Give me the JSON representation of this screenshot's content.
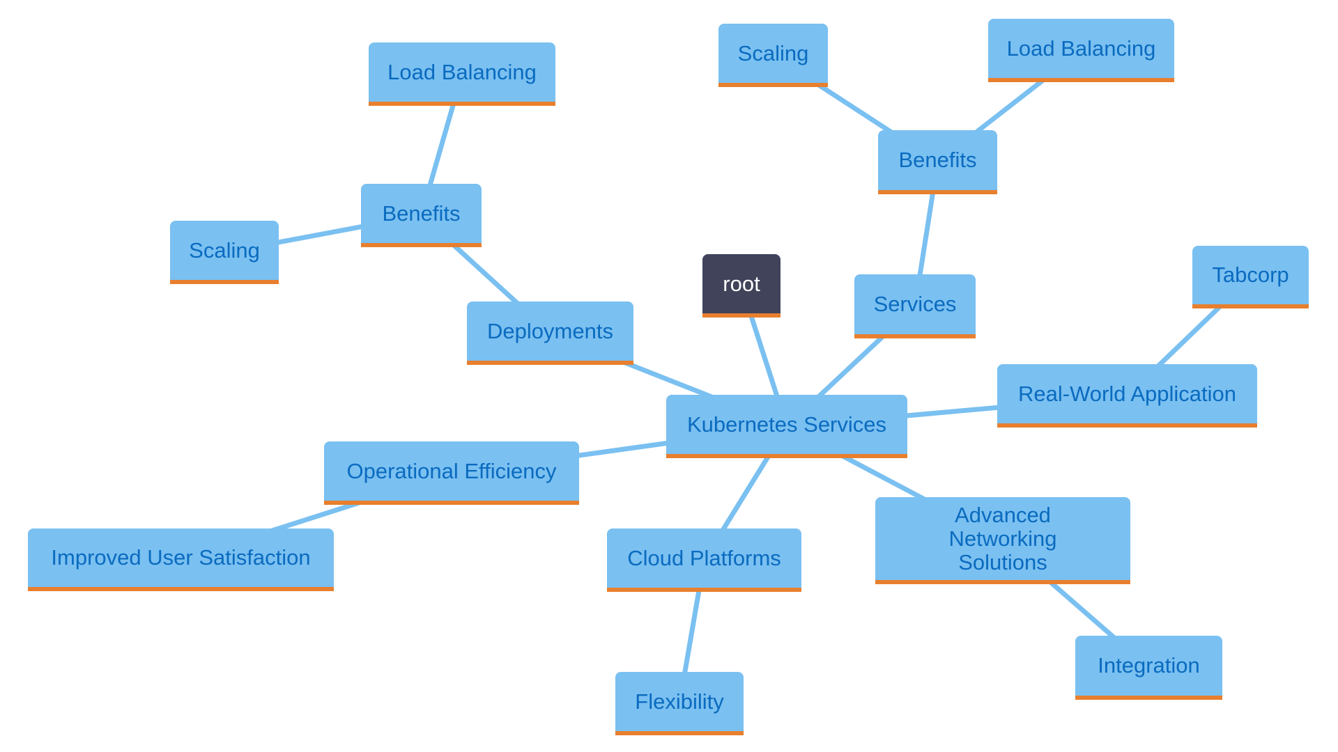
{
  "colors": {
    "node_fill": "#7ac0f1",
    "node_text": "#0a6bbf",
    "node_accent": "#e87f2e",
    "root_fill": "#40435a",
    "root_text": "#ffffff",
    "edge": "#7ac0f1"
  },
  "nodes": [
    {
      "id": "root",
      "label": "root",
      "type": "root"
    },
    {
      "id": "k8s",
      "label": "Kubernetes Services"
    },
    {
      "id": "deployments",
      "label": "Deployments"
    },
    {
      "id": "dep-benefits",
      "label": "Benefits"
    },
    {
      "id": "dep-load-balancing",
      "label": "Load Balancing"
    },
    {
      "id": "dep-scaling",
      "label": "Scaling"
    },
    {
      "id": "services",
      "label": "Services"
    },
    {
      "id": "svc-benefits",
      "label": "Benefits"
    },
    {
      "id": "svc-scaling",
      "label": "Scaling"
    },
    {
      "id": "svc-load-balancing",
      "label": "Load Balancing"
    },
    {
      "id": "real-world",
      "label": "Real-World Application"
    },
    {
      "id": "tabcorp",
      "label": "Tabcorp"
    },
    {
      "id": "op-efficiency",
      "label": "Operational Efficiency"
    },
    {
      "id": "user-satisfaction",
      "label": "Improved User Satisfaction"
    },
    {
      "id": "cloud-platforms",
      "label": "Cloud Platforms"
    },
    {
      "id": "flexibility",
      "label": "Flexibility"
    },
    {
      "id": "adv-networking",
      "label": "Advanced Networking Solutions"
    },
    {
      "id": "integration",
      "label": "Integration"
    }
  ],
  "edges": [
    [
      "root",
      "k8s"
    ],
    [
      "k8s",
      "deployments"
    ],
    [
      "deployments",
      "dep-benefits"
    ],
    [
      "dep-benefits",
      "dep-load-balancing"
    ],
    [
      "dep-benefits",
      "dep-scaling"
    ],
    [
      "k8s",
      "services"
    ],
    [
      "services",
      "svc-benefits"
    ],
    [
      "svc-benefits",
      "svc-scaling"
    ],
    [
      "svc-benefits",
      "svc-load-balancing"
    ],
    [
      "k8s",
      "real-world"
    ],
    [
      "real-world",
      "tabcorp"
    ],
    [
      "k8s",
      "op-efficiency"
    ],
    [
      "op-efficiency",
      "user-satisfaction"
    ],
    [
      "k8s",
      "cloud-platforms"
    ],
    [
      "cloud-platforms",
      "flexibility"
    ],
    [
      "k8s",
      "adv-networking"
    ],
    [
      "adv-networking",
      "integration"
    ]
  ]
}
